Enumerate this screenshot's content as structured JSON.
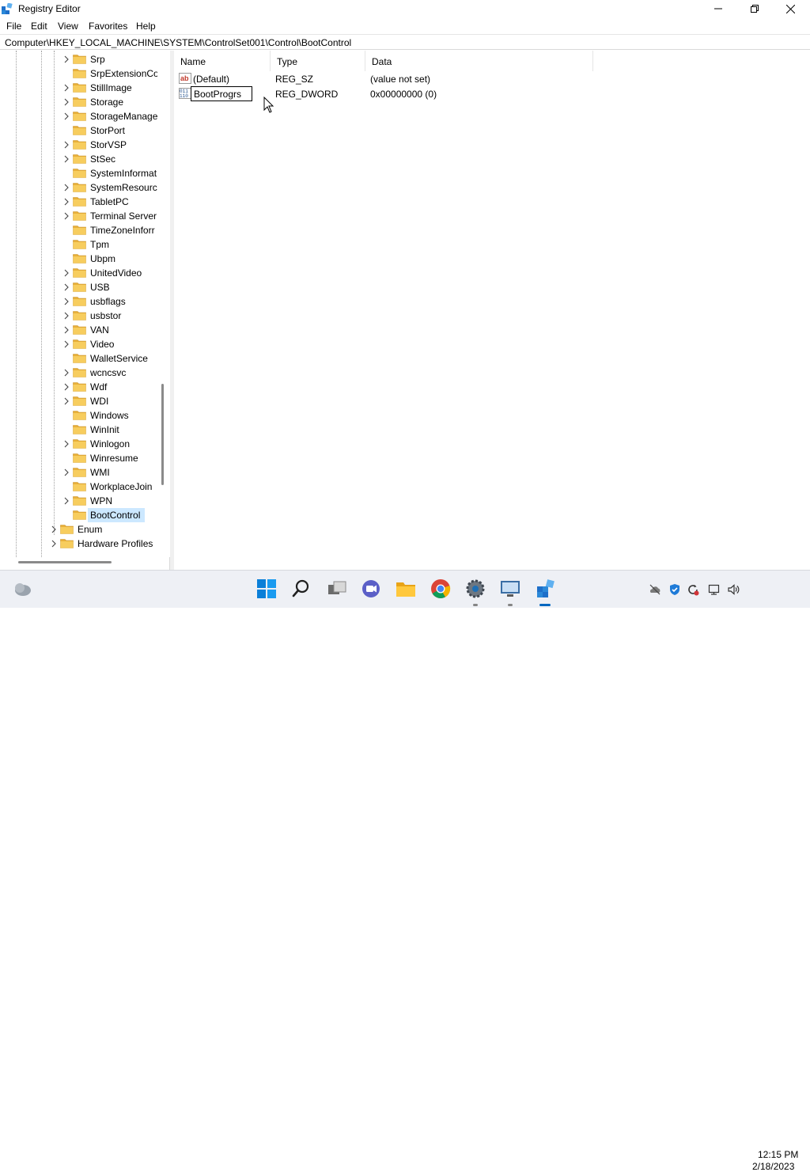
{
  "window": {
    "title": "Registry Editor",
    "menu": [
      "File",
      "Edit",
      "View",
      "Favorites",
      "Help"
    ],
    "address": "Computer\\HKEY_LOCAL_MACHINE\\SYSTEM\\ControlSet001\\Control\\BootControl"
  },
  "tree": {
    "items": [
      {
        "label": "Srp",
        "expandable": true
      },
      {
        "label": "SrpExtensionCo",
        "expandable": false
      },
      {
        "label": "StillImage",
        "expandable": true
      },
      {
        "label": "Storage",
        "expandable": true
      },
      {
        "label": "StorageManage",
        "expandable": true
      },
      {
        "label": "StorPort",
        "expandable": false
      },
      {
        "label": "StorVSP",
        "expandable": true
      },
      {
        "label": "StSec",
        "expandable": true
      },
      {
        "label": "SystemInformat",
        "expandable": false
      },
      {
        "label": "SystemResource",
        "expandable": true
      },
      {
        "label": "TabletPC",
        "expandable": true
      },
      {
        "label": "Terminal Server",
        "expandable": true
      },
      {
        "label": "TimeZoneInforr",
        "expandable": false
      },
      {
        "label": "Tpm",
        "expandable": false
      },
      {
        "label": "Ubpm",
        "expandable": false
      },
      {
        "label": "UnitedVideo",
        "expandable": true
      },
      {
        "label": "USB",
        "expandable": true
      },
      {
        "label": "usbflags",
        "expandable": true
      },
      {
        "label": "usbstor",
        "expandable": true
      },
      {
        "label": "VAN",
        "expandable": true
      },
      {
        "label": "Video",
        "expandable": true
      },
      {
        "label": "WalletService",
        "expandable": false
      },
      {
        "label": "wcncsvc",
        "expandable": true
      },
      {
        "label": "Wdf",
        "expandable": true
      },
      {
        "label": "WDI",
        "expandable": true
      },
      {
        "label": "Windows",
        "expandable": false
      },
      {
        "label": "WinInit",
        "expandable": false
      },
      {
        "label": "Winlogon",
        "expandable": true
      },
      {
        "label": "Winresume",
        "expandable": false
      },
      {
        "label": "WMI",
        "expandable": true
      },
      {
        "label": "WorkplaceJoin",
        "expandable": false
      },
      {
        "label": "WPN",
        "expandable": true
      },
      {
        "label": "BootControl",
        "expandable": false,
        "selected": true
      }
    ],
    "parent_items": [
      {
        "label": "Enum",
        "expandable": true
      },
      {
        "label": "Hardware Profiles",
        "expandable": true
      }
    ]
  },
  "list": {
    "columns": [
      "Name",
      "Type",
      "Data"
    ],
    "rows": [
      {
        "name": "(Default)",
        "type": "REG_SZ",
        "data": "(value not set)",
        "icon": "string-value-icon"
      },
      {
        "name": "BootProgrs",
        "type": "REG_DWORD",
        "data": "0x00000000 (0)",
        "icon": "binary-value-icon",
        "editing": true
      }
    ]
  },
  "taskbar": {
    "apps": [
      "start-icon",
      "search-icon",
      "task-view-icon",
      "teams-chat-icon",
      "file-explorer-icon",
      "chrome-icon",
      "settings-icon",
      "remote-desktop-icon",
      "registry-editor-icon"
    ],
    "clock": {
      "time": "12:15 PM",
      "date": "2/18/2023"
    }
  },
  "colors": {
    "selection": "#cce8ff",
    "folder": "#f5c542",
    "accent": "#0067c0"
  }
}
